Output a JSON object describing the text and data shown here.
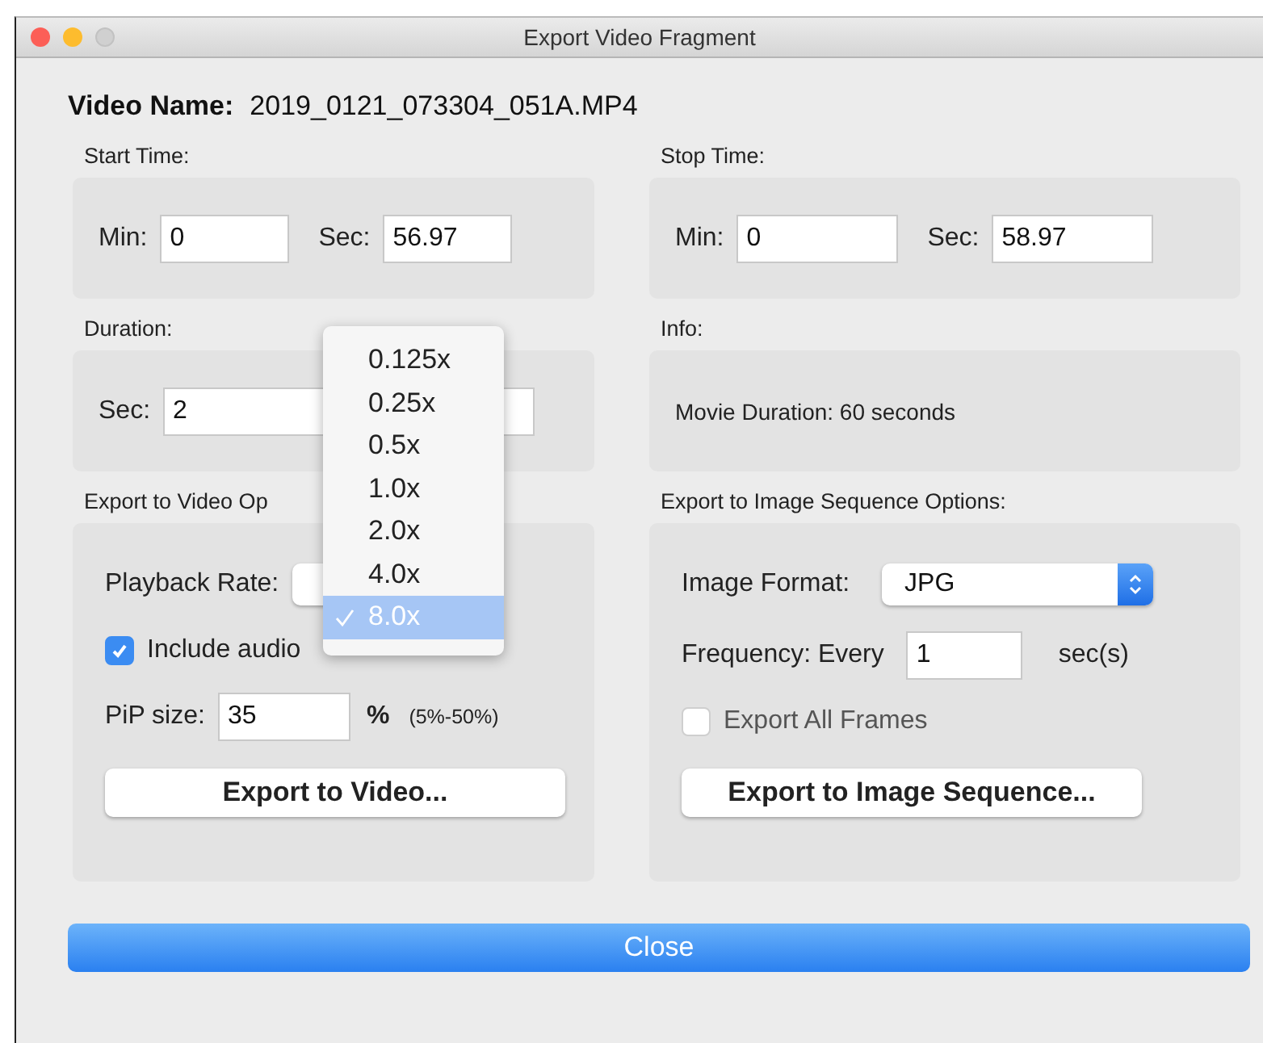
{
  "window": {
    "title": "Export Video Fragment"
  },
  "video_name": {
    "label": "Video Name:",
    "value": "2019_0121_073304_051A.MP4"
  },
  "start_time": {
    "label": "Start Time:",
    "min_label": "Min:",
    "min_value": "0",
    "sec_label": "Sec:",
    "sec_value": "56.97"
  },
  "stop_time": {
    "label": "Stop Time:",
    "min_label": "Min:",
    "min_value": "0",
    "sec_label": "Sec:",
    "sec_value": "58.97"
  },
  "duration": {
    "label": "Duration:",
    "sec_label": "Sec:",
    "sec_value": "2"
  },
  "info": {
    "label": "Info:",
    "text": "Movie Duration: 60 seconds"
  },
  "video_options": {
    "label": "Export to Video Op",
    "playback_rate_label": "Playback Rate:",
    "include_audio": {
      "label": "Include audio",
      "checked": true
    },
    "pip_label": "PiP size:",
    "pip_value": "35",
    "pip_unit": "%",
    "pip_range": "(5%-50%)",
    "export_button": "Export to Video..."
  },
  "image_options": {
    "label": "Export to Image Sequence Options:",
    "format_label": "Image Format:",
    "format_value": "JPG",
    "frequency_label": "Frequency: Every",
    "frequency_value": "1",
    "frequency_unit": "sec(s)",
    "export_all_frames": {
      "label": "Export All Frames",
      "checked": false
    },
    "export_button": "Export to Image Sequence..."
  },
  "playback_rate_menu": [
    {
      "label": "0.125x",
      "selected": false
    },
    {
      "label": "0.25x",
      "selected": false
    },
    {
      "label": "0.5x",
      "selected": false
    },
    {
      "label": "1.0x",
      "selected": false
    },
    {
      "label": "2.0x",
      "selected": false
    },
    {
      "label": "4.0x",
      "selected": false
    },
    {
      "label": "8.0x",
      "selected": true
    }
  ],
  "close_button": "Close"
}
